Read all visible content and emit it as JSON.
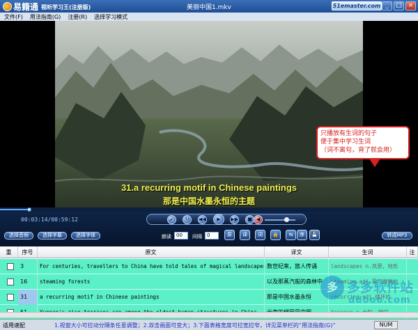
{
  "titlebar": {
    "logo_text": "易籍通",
    "logo_subtitle": "视听学习王(注册版)",
    "window_title": "美丽中国1.mkv",
    "site_badge": "51emaster.com",
    "minimize": "_",
    "maximize": "□",
    "close": "×"
  },
  "menu": [
    "文件(F)",
    "用法指南(G)",
    "注册(R)",
    "选择学习模式"
  ],
  "video": {
    "subtitle_en": "31.a recurring motif in Chinese paintings",
    "subtitle_zh": "那是中国水墨永恒的主题"
  },
  "callout": {
    "lines": [
      "只播放有生词的句子",
      "便于集中学习生词",
      "（词不离句，背了就会用）"
    ]
  },
  "player": {
    "time": "00:03:14/00:59:12",
    "progress": 0.07,
    "volume": 0.7
  },
  "controls": {
    "select_audio": "选择音频",
    "select_subtitle": "选择字幕",
    "select_font": "选择字体",
    "label_read": "朗读",
    "read_value": "00",
    "label_interval": "间隔",
    "interval_value": "0",
    "btn_original": "原",
    "btn_translation": "译",
    "btn_word": "词",
    "btn_order": "序",
    "convert_mp3": "转成MP3"
  },
  "table": {
    "headers": [
      "重",
      "序号",
      "原文",
      "译文",
      "生词",
      "注"
    ],
    "rows": [
      {
        "num": "3",
        "original": "For centuries, travellers to China have told tales of magical landscapes",
        "translation": "数世纪来，旅人传诵",
        "words": "landscapes n.风景，地形"
      },
      {
        "num": "16",
        "original": "steaming forests",
        "translation": "以及那蒸汽般的森林中",
        "words": "steaming adj.雾气腾腾的"
      },
      {
        "num": "31",
        "original": "a recurring motif in Chinese paintings",
        "translation": "那是中国水墨永恒",
        "words": "recurring adj.循环的"
      },
      {
        "num": "51",
        "original": "Yunnan's rice terraces are among the oldest human structures in China",
        "translation": "云南的梯田是中国",
        "words": "terrace n.台阶，梯田"
      }
    ]
  },
  "watermark": {
    "circle_char": "多",
    "name": "多多软件站",
    "url": "ddooo.com"
  },
  "status": {
    "left": "适用速配",
    "tip": "1.视窗大小可拉动分隔条任意调整；2.双击画面可变大；3.下面表格宽度可拉宽拉窄，详见菜单栏的“用法指南(G)”",
    "num": "NUM"
  }
}
